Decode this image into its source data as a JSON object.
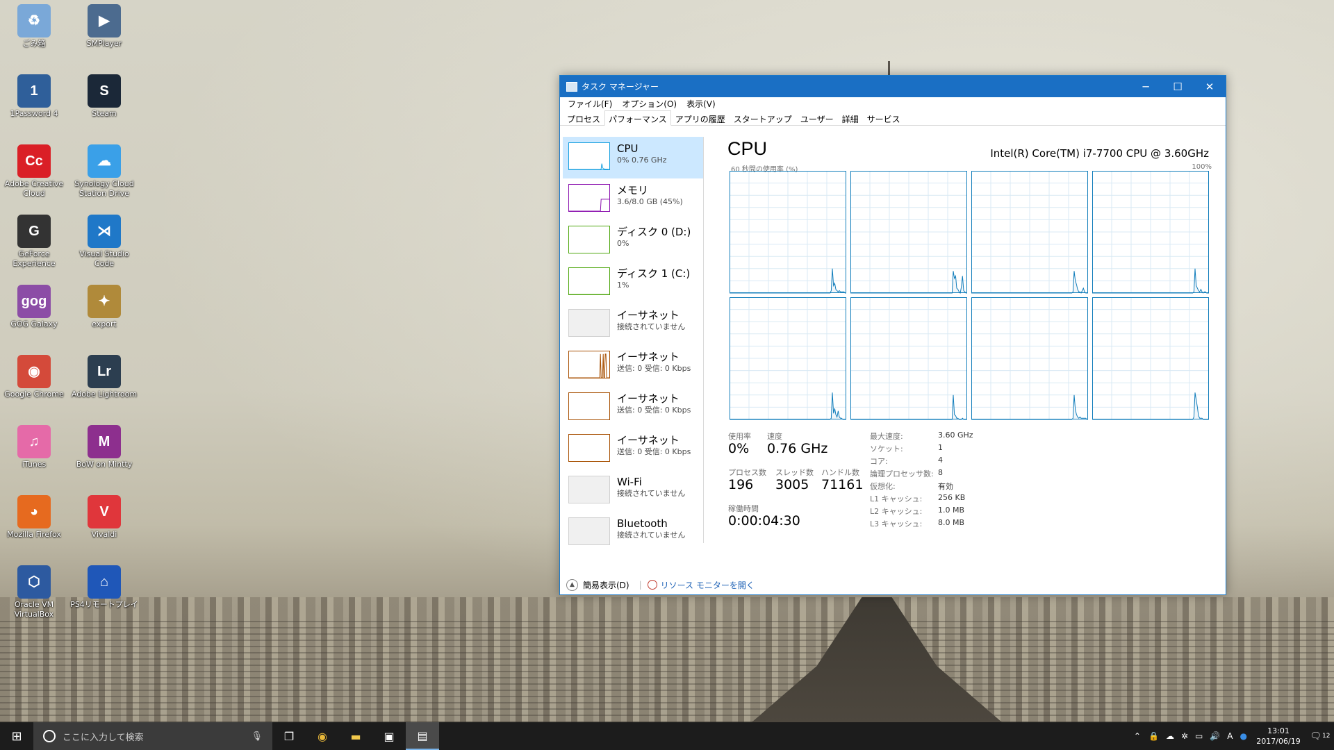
{
  "desktop": {
    "icons": [
      {
        "label": "ごみ箱",
        "icon": "recycle-bin-icon",
        "color": "#7aa8d8",
        "glyph": "♻"
      },
      {
        "label": "SMPlayer",
        "icon": "smplayer-icon",
        "color": "#4c6b8f",
        "glyph": "▶"
      },
      {
        "label": "1Password 4",
        "icon": "1password-icon",
        "color": "#2f5f9a",
        "glyph": "1"
      },
      {
        "label": "Steam",
        "icon": "steam-icon",
        "color": "#1b2838",
        "glyph": "S"
      },
      {
        "label": "Adobe Creative Cloud",
        "icon": "creative-cloud-icon",
        "color": "#da1f26",
        "glyph": "Cc"
      },
      {
        "label": "Synology Cloud Station Drive",
        "icon": "synology-icon",
        "color": "#3aa0e8",
        "glyph": "☁"
      },
      {
        "label": "GeForce Experience",
        "icon": "geforce-icon",
        "color": "#333333",
        "glyph": "G"
      },
      {
        "label": "Visual Studio Code",
        "icon": "vscode-icon",
        "color": "#1f78c8",
        "glyph": "⋊"
      },
      {
        "label": "GOG Galaxy",
        "icon": "gog-icon",
        "color": "#8c4da6",
        "glyph": "gog"
      },
      {
        "label": "export",
        "icon": "export-icon",
        "color": "#b08a3a",
        "glyph": "✦"
      },
      {
        "label": "Google Chrome",
        "icon": "chrome-icon",
        "color": "#d44a3a",
        "glyph": "◉"
      },
      {
        "label": "Adobe Lightroom",
        "icon": "lightroom-icon",
        "color": "#2c3e50",
        "glyph": "Lr"
      },
      {
        "label": "iTunes",
        "icon": "itunes-icon",
        "color": "#e56aa8",
        "glyph": "♫"
      },
      {
        "label": "BoW on Mintty",
        "icon": "mintty-icon",
        "color": "#8d2f8e",
        "glyph": "M"
      },
      {
        "label": "Mozilla Firefox",
        "icon": "firefox-icon",
        "color": "#e66a1f",
        "glyph": "◕"
      },
      {
        "label": "Vivaldi",
        "icon": "vivaldi-icon",
        "color": "#e0363b",
        "glyph": "V"
      },
      {
        "label": "Oracle VM VirtualBox",
        "icon": "virtualbox-icon",
        "color": "#2d5aa0",
        "glyph": "⬡"
      },
      {
        "label": "PS4リモートプレイ",
        "icon": "ps4-remote-icon",
        "color": "#1f57b8",
        "glyph": "⌂"
      }
    ]
  },
  "window": {
    "title": "タスク マネージャー",
    "menu": [
      "ファイル(F)",
      "オプション(O)",
      "表示(V)"
    ],
    "tabs": [
      "プロセス",
      "パフォーマンス",
      "アプリの履歴",
      "スタートアップ",
      "ユーザー",
      "詳細",
      "サービス"
    ],
    "active_tab": 1,
    "sidebar": [
      {
        "name": "CPU",
        "detail": "0%  0.76 GHz",
        "color": "#17a0e0",
        "selected": true,
        "spark": [
          0,
          0,
          0,
          0,
          0,
          0,
          0,
          0,
          0,
          0,
          0,
          0,
          0,
          0,
          0,
          0,
          0,
          0,
          0,
          0,
          0,
          0,
          0,
          0,
          0,
          0,
          0,
          0,
          0,
          0,
          0,
          0,
          0,
          0,
          0,
          0,
          0,
          0,
          0,
          0,
          0,
          0,
          0,
          0,
          0,
          0,
          0,
          2,
          22,
          8,
          3,
          2,
          2,
          1,
          1,
          1,
          1,
          1,
          0,
          0
        ]
      },
      {
        "name": "メモリ",
        "detail": "3.6/8.0 GB (45%)",
        "color": "#8b12ae",
        "selected": false,
        "spark": [
          0,
          0,
          0,
          0,
          0,
          0,
          0,
          0,
          0,
          0,
          0,
          0,
          0,
          0,
          0,
          0,
          0,
          0,
          0,
          0,
          0,
          0,
          0,
          0,
          0,
          0,
          0,
          0,
          0,
          0,
          0,
          0,
          0,
          0,
          0,
          0,
          0,
          0,
          0,
          0,
          0,
          0,
          0,
          0,
          0,
          0,
          0,
          45,
          45,
          45,
          45,
          45,
          45,
          45,
          45,
          45,
          45,
          45,
          45,
          45
        ]
      },
      {
        "name": "ディスク 0 (D:)",
        "detail": "0%",
        "color": "#4da60c",
        "selected": false,
        "spark": []
      },
      {
        "name": "ディスク 1 (C:)",
        "detail": "1%",
        "color": "#4da60c",
        "selected": false,
        "spark": [
          0,
          0,
          0,
          0,
          0,
          0,
          0,
          0,
          0,
          0,
          0,
          0,
          0,
          0,
          0,
          0,
          0,
          0,
          0,
          0,
          0,
          0,
          0,
          0,
          0,
          0,
          0,
          0,
          0,
          0,
          0,
          0,
          0,
          0,
          0,
          0,
          0,
          0,
          0,
          0,
          0,
          0,
          0,
          0,
          0,
          0,
          0,
          0,
          0,
          0,
          0,
          0,
          0,
          0,
          0,
          0,
          0,
          0,
          0,
          0
        ]
      },
      {
        "name": "イーサネット",
        "detail": "接続されていません",
        "color": "#d0d0d0",
        "selected": false,
        "spark": []
      },
      {
        "name": "イーサネット",
        "detail": "送信: 0  受信: 0 Kbps",
        "color": "#a74f01",
        "selected": false,
        "spark": [
          0,
          0,
          0,
          0,
          0,
          0,
          0,
          0,
          0,
          0,
          0,
          0,
          0,
          0,
          0,
          0,
          0,
          0,
          0,
          0,
          0,
          0,
          0,
          0,
          0,
          0,
          0,
          0,
          0,
          0,
          0,
          0,
          0,
          0,
          0,
          0,
          0,
          0,
          0,
          0,
          0,
          0,
          0,
          0,
          0,
          0,
          90,
          0,
          0,
          0,
          90,
          0,
          0,
          90,
          90,
          0,
          0,
          0,
          0,
          0
        ]
      },
      {
        "name": "イーサネット",
        "detail": "送信: 0  受信: 0 Kbps",
        "color": "#a74f01",
        "selected": false,
        "spark": []
      },
      {
        "name": "イーサネット",
        "detail": "送信: 0  受信: 0 Kbps",
        "color": "#a74f01",
        "selected": false,
        "spark": []
      },
      {
        "name": "Wi-Fi",
        "detail": "接続されていません",
        "color": "#d0d0d0",
        "selected": false,
        "spark": []
      },
      {
        "name": "Bluetooth",
        "detail": "接続されていません",
        "color": "#d0d0d0",
        "selected": false,
        "spark": []
      }
    ],
    "perf": {
      "title": "CPU",
      "processor_name": "Intel(R) Core(TM) i7-7700 CPU @ 3.60GHz",
      "graph_label": "60 秒間の使用率 (%)",
      "graph_max": "100%",
      "cores": [
        [
          0,
          0,
          0,
          0,
          0,
          0,
          0,
          0,
          0,
          0,
          0,
          0,
          0,
          0,
          0,
          0,
          0,
          0,
          0,
          0,
          0,
          0,
          0,
          0,
          0,
          0,
          0,
          0,
          0,
          0,
          0,
          0,
          0,
          0,
          0,
          0,
          0,
          0,
          0,
          0,
          0,
          0,
          0,
          0,
          0,
          0,
          0,
          0,
          0,
          0,
          0,
          0,
          0,
          0,
          0,
          0,
          0,
          0,
          0,
          0,
          0,
          0,
          0,
          0,
          0,
          0,
          0,
          0,
          0,
          0,
          0,
          0,
          0,
          0,
          0,
          0,
          0,
          0,
          0,
          0,
          0,
          0,
          0,
          0,
          0,
          0,
          0,
          0,
          2,
          20,
          6,
          8,
          3,
          2,
          1,
          2,
          1,
          1,
          1,
          1,
          0,
          0
        ],
        [
          0,
          0,
          0,
          0,
          0,
          0,
          0,
          0,
          0,
          0,
          0,
          0,
          0,
          0,
          0,
          0,
          0,
          0,
          0,
          0,
          0,
          0,
          0,
          0,
          0,
          0,
          0,
          0,
          0,
          0,
          0,
          0,
          0,
          0,
          0,
          0,
          0,
          0,
          0,
          0,
          0,
          0,
          0,
          0,
          0,
          0,
          0,
          0,
          0,
          0,
          0,
          0,
          0,
          0,
          0,
          0,
          0,
          0,
          0,
          0,
          0,
          0,
          0,
          0,
          0,
          0,
          0,
          0,
          0,
          0,
          0,
          0,
          0,
          0,
          0,
          0,
          0,
          0,
          0,
          0,
          0,
          0,
          0,
          0,
          0,
          0,
          0,
          0,
          0,
          18,
          12,
          14,
          4,
          3,
          1,
          0,
          5,
          14,
          2,
          1,
          0,
          0
        ],
        [
          0,
          0,
          0,
          0,
          0,
          0,
          0,
          0,
          0,
          0,
          0,
          0,
          0,
          0,
          0,
          0,
          0,
          0,
          0,
          0,
          0,
          0,
          0,
          0,
          0,
          0,
          0,
          0,
          0,
          0,
          0,
          0,
          0,
          0,
          0,
          0,
          0,
          0,
          0,
          0,
          0,
          0,
          0,
          0,
          0,
          0,
          0,
          0,
          0,
          0,
          0,
          0,
          0,
          0,
          0,
          0,
          0,
          0,
          0,
          0,
          0,
          0,
          0,
          0,
          0,
          0,
          0,
          0,
          0,
          0,
          0,
          0,
          0,
          0,
          0,
          0,
          0,
          0,
          0,
          0,
          0,
          0,
          0,
          0,
          0,
          0,
          0,
          0,
          1,
          18,
          10,
          7,
          3,
          1,
          1,
          0,
          2,
          4,
          1,
          0,
          0,
          0
        ],
        [
          0,
          0,
          0,
          0,
          0,
          0,
          0,
          0,
          0,
          0,
          0,
          0,
          0,
          0,
          0,
          0,
          0,
          0,
          0,
          0,
          0,
          0,
          0,
          0,
          0,
          0,
          0,
          0,
          0,
          0,
          0,
          0,
          0,
          0,
          0,
          0,
          0,
          0,
          0,
          0,
          0,
          0,
          0,
          0,
          0,
          0,
          0,
          0,
          0,
          0,
          0,
          0,
          0,
          0,
          0,
          0,
          0,
          0,
          0,
          0,
          0,
          0,
          0,
          0,
          0,
          0,
          0,
          0,
          0,
          0,
          0,
          0,
          0,
          0,
          0,
          0,
          0,
          0,
          0,
          0,
          0,
          0,
          0,
          0,
          0,
          0,
          0,
          0,
          1,
          20,
          6,
          4,
          2,
          1,
          3,
          1,
          0,
          1,
          1,
          0,
          0,
          0
        ],
        [
          0,
          0,
          0,
          0,
          0,
          0,
          0,
          0,
          0,
          0,
          0,
          0,
          0,
          0,
          0,
          0,
          0,
          0,
          0,
          0,
          0,
          0,
          0,
          0,
          0,
          0,
          0,
          0,
          0,
          0,
          0,
          0,
          0,
          0,
          0,
          0,
          0,
          0,
          0,
          0,
          0,
          0,
          0,
          0,
          0,
          0,
          0,
          0,
          0,
          0,
          0,
          0,
          0,
          0,
          0,
          0,
          0,
          0,
          0,
          0,
          0,
          0,
          0,
          0,
          0,
          0,
          0,
          0,
          0,
          0,
          0,
          0,
          0,
          0,
          0,
          0,
          0,
          0,
          0,
          0,
          0,
          0,
          0,
          0,
          0,
          0,
          0,
          0,
          1,
          22,
          5,
          9,
          4,
          2,
          7,
          2,
          1,
          1,
          0,
          0,
          0,
          0
        ],
        [
          0,
          0,
          0,
          0,
          0,
          0,
          0,
          0,
          0,
          0,
          0,
          0,
          0,
          0,
          0,
          0,
          0,
          0,
          0,
          0,
          0,
          0,
          0,
          0,
          0,
          0,
          0,
          0,
          0,
          0,
          0,
          0,
          0,
          0,
          0,
          0,
          0,
          0,
          0,
          0,
          0,
          0,
          0,
          0,
          0,
          0,
          0,
          0,
          0,
          0,
          0,
          0,
          0,
          0,
          0,
          0,
          0,
          0,
          0,
          0,
          0,
          0,
          0,
          0,
          0,
          0,
          0,
          0,
          0,
          0,
          0,
          0,
          0,
          0,
          0,
          0,
          0,
          0,
          0,
          0,
          0,
          0,
          0,
          0,
          0,
          0,
          0,
          0,
          0,
          20,
          4,
          3,
          1,
          1,
          0,
          0,
          0,
          1,
          0,
          0,
          0,
          0
        ],
        [
          0,
          0,
          0,
          0,
          0,
          0,
          0,
          0,
          0,
          0,
          0,
          0,
          0,
          0,
          0,
          0,
          0,
          0,
          0,
          0,
          0,
          0,
          0,
          0,
          0,
          0,
          0,
          0,
          0,
          0,
          0,
          0,
          0,
          0,
          0,
          0,
          0,
          0,
          0,
          0,
          0,
          0,
          0,
          0,
          0,
          0,
          0,
          0,
          0,
          0,
          0,
          0,
          0,
          0,
          0,
          0,
          0,
          0,
          0,
          0,
          0,
          0,
          0,
          0,
          0,
          0,
          0,
          0,
          0,
          0,
          0,
          0,
          0,
          0,
          0,
          0,
          0,
          0,
          0,
          0,
          0,
          0,
          0,
          0,
          0,
          0,
          0,
          0,
          1,
          20,
          8,
          4,
          2,
          1,
          2,
          1,
          1,
          1,
          1,
          1,
          0,
          0
        ],
        [
          0,
          0,
          0,
          0,
          0,
          0,
          0,
          0,
          0,
          0,
          0,
          0,
          0,
          0,
          0,
          0,
          0,
          0,
          0,
          0,
          0,
          0,
          0,
          0,
          0,
          0,
          0,
          0,
          0,
          0,
          0,
          0,
          0,
          0,
          0,
          0,
          0,
          0,
          0,
          0,
          0,
          0,
          0,
          0,
          0,
          0,
          0,
          0,
          0,
          0,
          0,
          0,
          0,
          0,
          0,
          0,
          0,
          0,
          0,
          0,
          0,
          0,
          0,
          0,
          0,
          0,
          0,
          0,
          0,
          0,
          0,
          0,
          0,
          0,
          0,
          0,
          0,
          0,
          0,
          0,
          0,
          0,
          0,
          0,
          0,
          0,
          0,
          0,
          2,
          22,
          16,
          10,
          3,
          1,
          1,
          1,
          0,
          0,
          0,
          0,
          0,
          0
        ]
      ],
      "usage_label": "使用率",
      "usage": "0%",
      "speed_label": "速度",
      "speed": "0.76 GHz",
      "processes_label": "プロセス数",
      "processes": "196",
      "threads_label": "スレッド数",
      "threads": "3005",
      "handles_label": "ハンドル数",
      "handles": "71161",
      "uptime_label": "稼働時間",
      "uptime": "0:00:04:30",
      "specs": [
        {
          "k": "最大速度:",
          "v": "3.60 GHz"
        },
        {
          "k": "ソケット:",
          "v": "1"
        },
        {
          "k": "コア:",
          "v": "4"
        },
        {
          "k": "論理プロセッサ数:",
          "v": "8"
        },
        {
          "k": "仮想化:",
          "v": "有効"
        },
        {
          "k": "L1 キャッシュ:",
          "v": "256 KB"
        },
        {
          "k": "L2 キャッシュ:",
          "v": "1.0 MB"
        },
        {
          "k": "L3 キャッシュ:",
          "v": "8.0 MB"
        }
      ]
    },
    "footer": {
      "fewer_details": "簡易表示(D)",
      "resource_monitor": "リソース モニターを開く"
    }
  },
  "taskbar": {
    "search_placeholder": "ここに入力して検索",
    "time": "13:01",
    "date": "2017/06/19",
    "notification_count": "12",
    "ime": "A"
  }
}
